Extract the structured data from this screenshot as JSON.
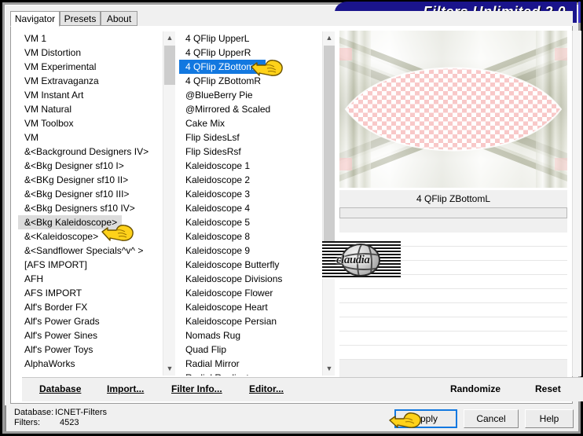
{
  "window": {
    "title": "Filters Unlimited 2.0",
    "title_bg": "#1a148c",
    "title_fg": "#ffffff"
  },
  "tabs": [
    {
      "label": "Navigator",
      "active": true
    },
    {
      "label": "Presets",
      "active": false
    },
    {
      "label": "About",
      "active": false
    }
  ],
  "categories": {
    "name": "filter-category-list",
    "selected": "&<Bkg Kaleidoscope>",
    "selected_bg": "#dcdcdc",
    "items": [
      "VM 1",
      "VM Distortion",
      "VM Experimental",
      "VM Extravaganza",
      "VM Instant Art",
      "VM Natural",
      "VM Toolbox",
      "VM",
      "&<Background Designers IV>",
      "&<Bkg Designer sf10 I>",
      "&<BKg Designer sf10 II>",
      "&<Bkg Designer sf10 III>",
      "&<Bkg Designers sf10 IV>",
      "&<Bkg Kaleidoscope>",
      "&<Kaleidoscope>",
      "&<Sandflower Specials^v^ >",
      "[AFS IMPORT]",
      "AFH",
      "AFS IMPORT",
      "Alf's Border FX",
      "Alf's Power Grads",
      "Alf's Power Sines",
      "Alf's Power Toys",
      "AlphaWorks"
    ]
  },
  "filters": {
    "name": "filter-effect-list",
    "selected": "4 QFlip ZBottomL",
    "selected_bg": "#1278e0",
    "items": [
      "4 QFlip UpperL",
      "4 QFlip UpperR",
      "4 QFlip ZBottomL",
      "4 QFlip ZBottomR",
      "@BlueBerry Pie",
      "@Mirrored & Scaled",
      "Cake Mix",
      "Flip SidesLsf",
      "Flip SidesRsf",
      "Kaleidoscope 1",
      "Kaleidoscope 2",
      "Kaleidoscope 3",
      "Kaleidoscope 4",
      "Kaleidoscope 5",
      "Kaleidoscope 8",
      "Kaleidoscope 9",
      "Kaleidoscope Butterfly",
      "Kaleidoscope Divisions",
      "Kaleidoscope Flower",
      "Kaleidoscope Heart",
      "Kaleidoscope Persian",
      "Nomads Rug",
      "Quad Flip",
      "Radial Mirror",
      "Radial Replicate"
    ]
  },
  "preview": {
    "filter_name": "4 QFlip ZBottomL",
    "checker_color": "#f8c8c8"
  },
  "watermark": {
    "text": "claudia"
  },
  "toolbar": {
    "database_label": "Database",
    "import_label": "Import...",
    "filter_info_label": "Filter Info...",
    "editor_label": "Editor...",
    "randomize_label": "Randomize",
    "reset_label": "Reset"
  },
  "status": {
    "database_label": "Database:",
    "database_value": "ICNET-Filters",
    "filters_label": "Filters:",
    "filters_value": "4523"
  },
  "actions": {
    "apply_label": "Apply",
    "cancel_label": "Cancel",
    "help_label": "Help"
  }
}
